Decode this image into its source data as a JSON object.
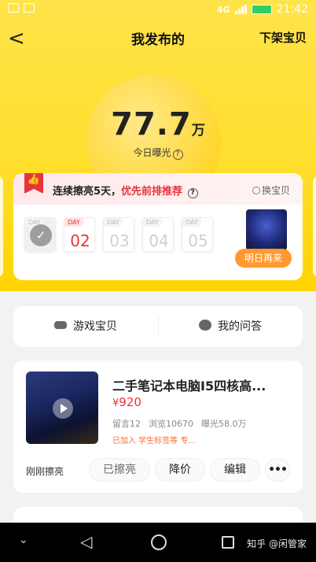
{
  "status": {
    "network": "4G",
    "time": "21:42"
  },
  "nav": {
    "back": "<",
    "title": "我发布的",
    "action": "下架宝贝"
  },
  "exposure": {
    "number": "77.7",
    "unit": "万",
    "label": "今日曝光",
    "help": "?"
  },
  "boost": {
    "title_pre": "连续擦亮5天，",
    "title_hl": "优先前排推荐",
    "help": "?",
    "switch_label": "换宝贝",
    "day_tag": "DAY",
    "days": [
      {
        "num": "",
        "state": "done"
      },
      {
        "num": "02",
        "state": "current"
      },
      {
        "num": "03",
        "state": "future"
      },
      {
        "num": "04",
        "state": "future"
      },
      {
        "num": "05",
        "state": "future"
      }
    ],
    "button": "明日再来"
  },
  "tabs": [
    {
      "label": "游戏宝贝",
      "icon": "gamepad-icon"
    },
    {
      "label": "我的问答",
      "icon": "chat-bubble-icon"
    }
  ],
  "item": {
    "title": "二手笔记本电脑I5四核高...",
    "currency": "¥",
    "price": "920",
    "stats": {
      "comments": "留言12",
      "views": "浏览10670",
      "exposure": "曝光58.0万"
    },
    "tag": "已加入 学生标签等 专...",
    "status": "刚刚擦亮",
    "buttons": {
      "polished": "已擦亮",
      "reduce": "降价",
      "edit": "编辑",
      "more": "•••"
    }
  },
  "watermark": "知乎 @闲管家"
}
